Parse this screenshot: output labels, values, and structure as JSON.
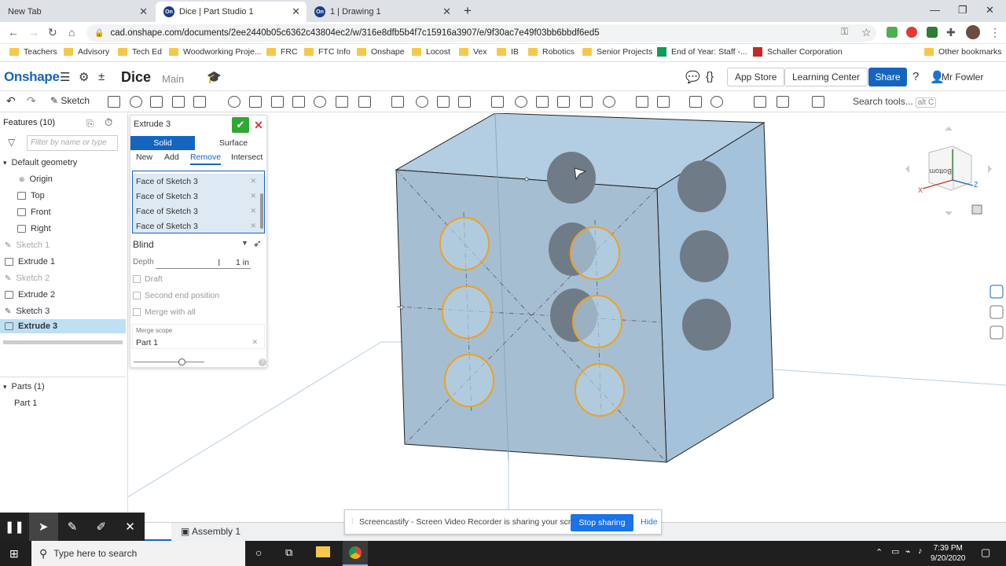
{
  "browser": {
    "tabs": [
      {
        "title": "New Tab"
      },
      {
        "title": "Dice | Part Studio 1"
      },
      {
        "title": "1 | Drawing 1"
      }
    ],
    "url": "cad.onshape.com/documents/2ee2440b05c6362c43804ec2/w/316e8dfb5b4f7c15916a3907/e/9f30ac7e49f03bb6bbdf6ed5",
    "bookmarks": [
      "Teachers",
      "Advisory",
      "Tech Ed",
      "Woodworking Proje...",
      "FRC",
      "FTC Info",
      "Onshape",
      "Locost",
      "Vex",
      "IB",
      "Robotics",
      "Senior Projects",
      "End of Year: Staff -...",
      "Schaller Corporation",
      "Other bookmarks"
    ]
  },
  "header": {
    "logo": "Onshape",
    "doc_name": "Dice",
    "workspace": "Main",
    "app_store": "App Store",
    "learning_center": "Learning Center",
    "share": "Share",
    "user": "Mr Fowler"
  },
  "toolbar": {
    "sketch": "Sketch",
    "search_tools": "Search tools...",
    "search_shortcut": "alt C"
  },
  "feature_tree": {
    "header": "Features (10)",
    "filter_placeholder": "Filter by name or type",
    "default_geometry": "Default geometry",
    "items": [
      "Origin",
      "Top",
      "Front",
      "Right",
      "Sketch 1",
      "Extrude 1",
      "Sketch 2",
      "Extrude 2",
      "Sketch 3",
      "Extrude 3"
    ],
    "parts_header": "Parts (1)",
    "parts": [
      "Part 1"
    ]
  },
  "extrude_dialog": {
    "title": "Extrude 3",
    "type_solid": "Solid",
    "type_surface": "Surface",
    "ops": [
      "New",
      "Add",
      "Remove",
      "Intersect"
    ],
    "faces": [
      "Face of Sketch 3",
      "Face of Sketch 3",
      "Face of Sketch 3",
      "Face of Sketch 3"
    ],
    "end_type": "Blind",
    "depth_label": "Depth",
    "depth_value": "1 in",
    "draft": "Draft",
    "second_end": "Second end position",
    "merge_all": "Merge with all",
    "merge_scope_label": "Merge scope",
    "merge_scope_value": "Part 1"
  },
  "viewcube": {
    "face_label": "Bottom",
    "axis_x": "X",
    "axis_z": "Z"
  },
  "bottom_tabs": {
    "assembly": "Assembly 1"
  },
  "screencastify": {
    "message": "Screencastify - Screen Video Recorder is sharing your screen.",
    "stop": "Stop sharing",
    "hide": "Hide"
  },
  "taskbar": {
    "search_placeholder": "Type here to search",
    "time": "7:39 PM",
    "date": "9/20/2020"
  },
  "colors": {
    "onshape_blue": "#1565c0",
    "highlight_orange": "#f0a020",
    "part_blue": "#a9c7dd"
  }
}
